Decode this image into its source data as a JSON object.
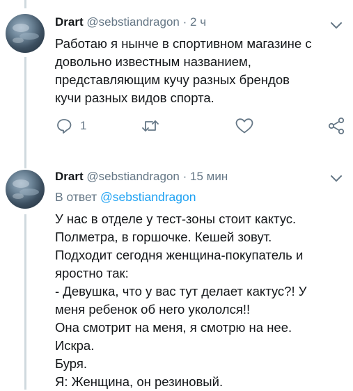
{
  "tweets": [
    {
      "author_name": "Drart",
      "author_handle": "@sebstiandragon",
      "separator": "·",
      "time": "2 ч",
      "lines": [
        "Работаю я нынче в спортивном магазине с",
        "довольно известным названием,",
        "представляющим кучу разных брендов",
        "кучи разных видов спорта."
      ],
      "reply_count": "1",
      "icons": [
        "reply-icon",
        "retweet-icon",
        "like-icon",
        "share-icon"
      ]
    },
    {
      "author_name": "Drart",
      "author_handle": "@sebstiandragon",
      "separator": "·",
      "time": "15 мин",
      "reply_prefix": "В ответ",
      "reply_mention": "@sebstiandragon",
      "lines": [
        "У нас в отделе у тест-зоны стоит кактус.",
        "Полметра, в горшочке. Кешей зовут.",
        "Подходит сегодня женщина-покупатель и",
        "яростно так:",
        "- Девушка, что у вас тут делает кактус?! У",
        "меня ребенок об него укололся!!",
        "Она смотрит на меня, я смотрю на нее.",
        "Искра.",
        "Буря.",
        "Я: Женщина, он резиновый."
      ]
    }
  ],
  "colors": {
    "text": "#14171a",
    "secondary": "#657786",
    "link": "#1da1f2",
    "thread_line": "#cfd9de"
  }
}
